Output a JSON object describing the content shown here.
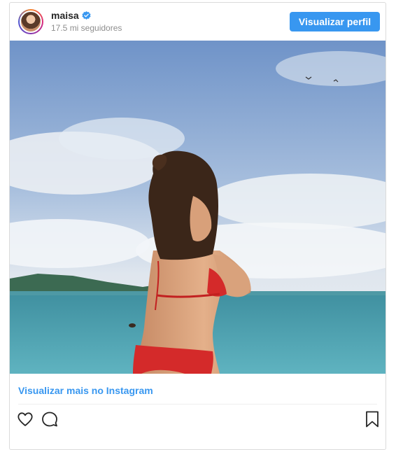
{
  "post": {
    "username": "maisa",
    "followers": "17.5 mi seguidores",
    "verified_icon": "verified-badge-icon",
    "view_profile_label": "Visualizar perfil",
    "view_more_label": "Visualizar mais no Instagram"
  },
  "actions": {
    "icons": [
      "heart-icon",
      "comment-icon",
      "bookmark-icon"
    ]
  },
  "colors": {
    "accent": "#3897f0",
    "border": "#dbdbdb",
    "muted_text": "#8e8e8e",
    "swimsuit": "#d42a2a"
  }
}
